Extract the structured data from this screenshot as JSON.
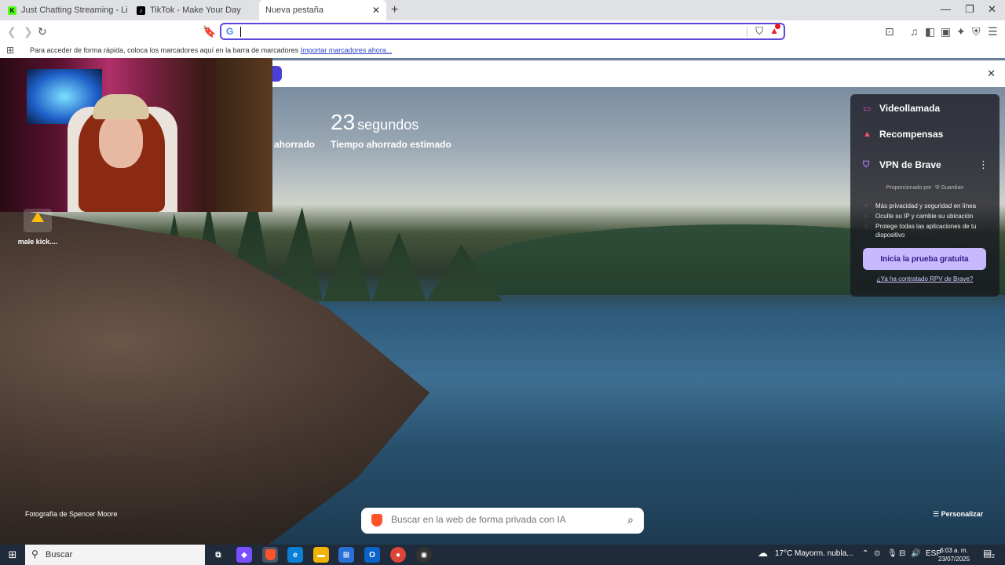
{
  "tabs": [
    {
      "label": "Just Chatting Streaming - Live Stream",
      "favicon": "kick-icon",
      "color": "#53fc18"
    },
    {
      "label": "TikTok - Make Your Day",
      "favicon": "tiktok-icon",
      "color": "#000000"
    },
    {
      "label": "Nueva pestaña",
      "active": true
    }
  ],
  "toolbar": {
    "search_engine_badge": "G",
    "url_value": ""
  },
  "bookmarks": {
    "hint": "Para acceder de forma rápida, coloca los marcadores aquí en la barra de marcadores",
    "import_link": "Importar marcadores ahora..."
  },
  "stats": {
    "time_value": "23",
    "time_unit": "segundos",
    "time_label": "Tiempo ahorrado estimado",
    "partial_label": "ahorrado"
  },
  "desktop_icon": {
    "label": "male kick...."
  },
  "panel": {
    "video_call": "Videollamada",
    "rewards": "Recompensas",
    "vpn_title": "VPN de Brave",
    "powered_by": "Proporcionado por",
    "powered_brand": "Guardian",
    "bullets": [
      "Más privacidad y seguridad en línea",
      "Oculte su IP y cambie su ubicación",
      "Protege todas las aplicaciones de tu dispositivo"
    ],
    "trial_button": "Inicia la prueba gratuita",
    "already_link": "¿Ya ha contratado RPV de Brave?"
  },
  "search": {
    "placeholder": "Buscar en la web de forma privada con IA"
  },
  "photo_credit": "Fotografía de Spencer Moore",
  "customize": "Personalizar",
  "taskbar": {
    "search_label": "Buscar",
    "weather_temp": "17°C",
    "weather_desc": "Mayorm. nubla...",
    "lang": "ESP",
    "time": "6:03 a. m.",
    "date": "23/07/2025",
    "notif_count": "2"
  },
  "colors": {
    "accent": "#5b47d9",
    "trial_bg": "#c8b9ff",
    "brave": "#fb542b"
  }
}
